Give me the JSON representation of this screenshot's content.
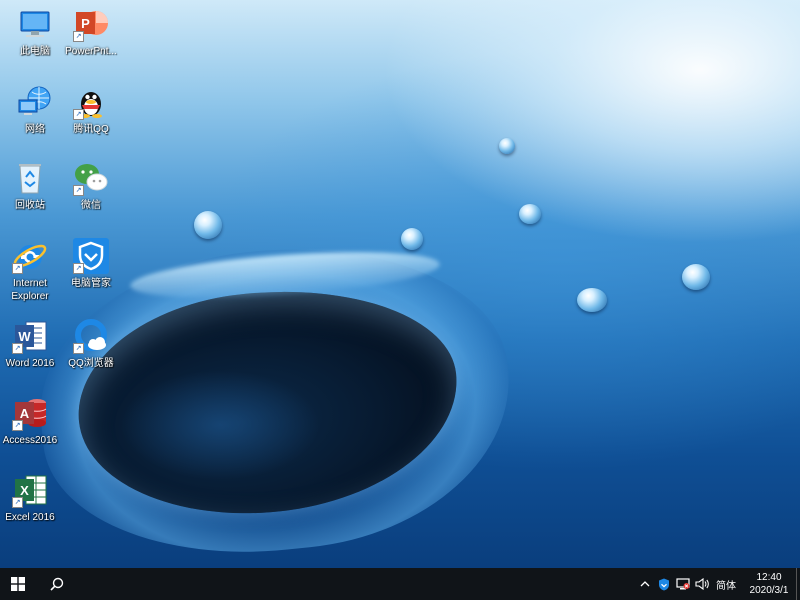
{
  "desktop": {
    "icons": [
      {
        "label": "此电脑",
        "icon": "this-pc-icon"
      },
      {
        "label": "PowerPnt...",
        "icon": "powerpoint-icon"
      },
      {
        "label": "网络",
        "icon": "network-icon"
      },
      {
        "label": "腾讯QQ",
        "icon": "qq-icon"
      },
      {
        "label": "回收站",
        "icon": "recycle-bin-icon"
      },
      {
        "label": "微信",
        "icon": "wechat-icon"
      },
      {
        "label": "Internet\nExplorer",
        "icon": "internet-explorer-icon"
      },
      {
        "label": "电脑管家",
        "icon": "pc-manager-icon"
      },
      {
        "label": "Word 2016",
        "icon": "word-icon"
      },
      {
        "label": "QQ浏览器",
        "icon": "qq-browser-icon"
      },
      {
        "label": "Access2016",
        "icon": "access-icon"
      },
      {
        "label": "Excel 2016",
        "icon": "excel-icon"
      }
    ]
  },
  "taskbar": {
    "start_icon": "windows-start-icon",
    "search_icon": "search-icon",
    "tray": {
      "chevron_icon": "chevron-up-icon",
      "security_icon": "shield-icon",
      "network_icon": "network-disconnected-icon",
      "volume_icon": "speaker-icon",
      "ime_label": "简体",
      "time": "12:40",
      "date": "2020/3/1"
    }
  },
  "colors": {
    "taskbar": "#101418",
    "accent": "#1a5fb4"
  }
}
